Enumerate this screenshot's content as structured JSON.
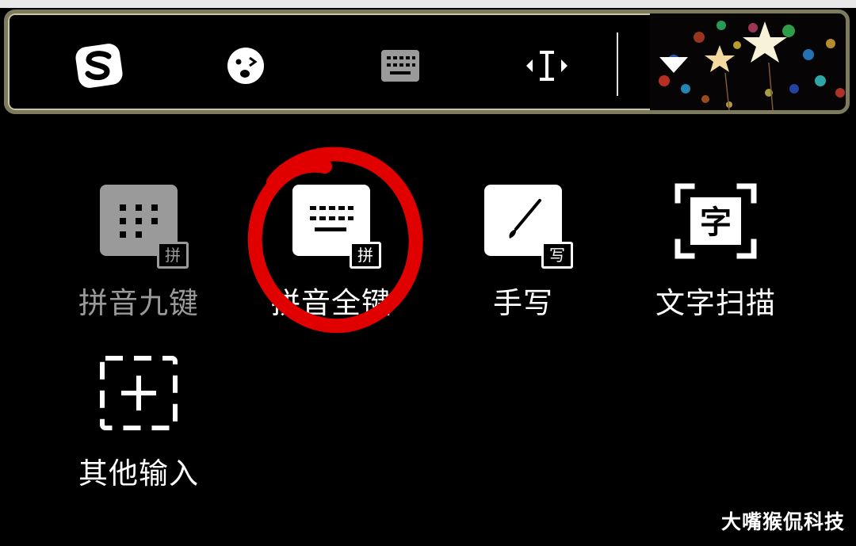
{
  "toolbar": {
    "buttons": [
      {
        "name": "sogou-logo",
        "icon": "sogou-s-icon"
      },
      {
        "name": "emoji",
        "icon": "emoji-face-icon"
      },
      {
        "name": "keyboard",
        "icon": "keyboard-icon"
      },
      {
        "name": "cursor",
        "icon": "cursor-move-icon"
      },
      {
        "name": "collapse",
        "icon": "triangle-down-icon"
      }
    ],
    "skin": "bokeh-stars"
  },
  "input_modes": [
    {
      "label": "拼音九键",
      "badge": "拼",
      "state": "disabled"
    },
    {
      "label": "拼音全键",
      "badge": "拼",
      "state": "active"
    },
    {
      "label": "手写",
      "badge": "写",
      "state": "active"
    },
    {
      "label": "文字扫描",
      "badge": "字",
      "state": "active"
    },
    {
      "label": "其他输入",
      "badge": "",
      "state": "active"
    }
  ],
  "annotation": {
    "color": "#e00000",
    "shape": "hand-drawn-circle"
  },
  "watermark": "大嘴猴侃科技",
  "colors": {
    "background": "#000000",
    "text": "#ffffff",
    "disabled": "#9a9a9a",
    "frame": "#7d7a5e"
  }
}
